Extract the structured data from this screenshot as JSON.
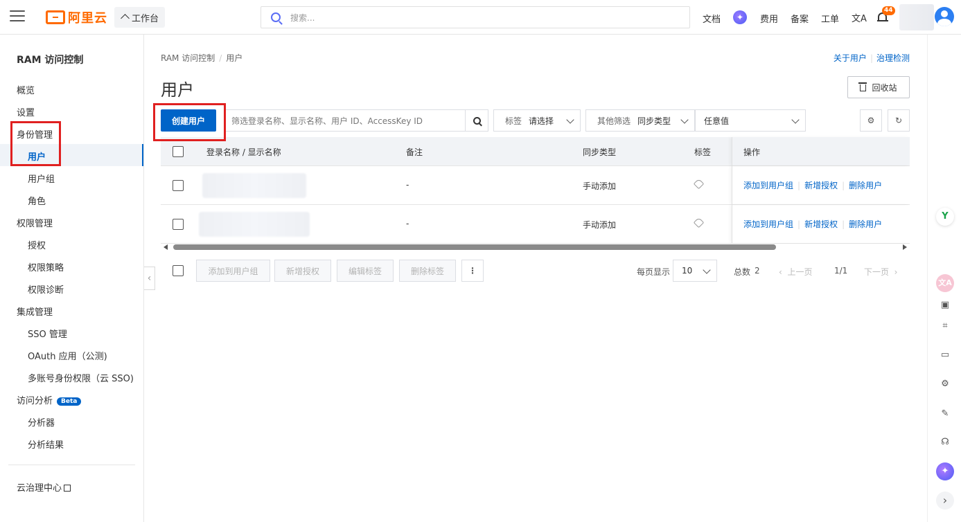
{
  "topnav": {
    "logo_text": "阿里云",
    "workbench": "工作台",
    "search_placeholder": "搜索...",
    "docs": "文档",
    "ai_glyph": "✦",
    "billing": "费用",
    "filing": "备案",
    "ticket": "工单",
    "lang_glyph": "文A",
    "notification_count": "44"
  },
  "sidebar": {
    "title": "RAM 访问控制",
    "items": [
      {
        "label": "概览"
      },
      {
        "label": "设置"
      },
      {
        "label": "身份管理"
      },
      {
        "label": "用户"
      },
      {
        "label": "用户组"
      },
      {
        "label": "角色"
      },
      {
        "label": "权限管理"
      },
      {
        "label": "授权"
      },
      {
        "label": "权限策略"
      },
      {
        "label": "权限诊断"
      },
      {
        "label": "集成管理"
      },
      {
        "label": "SSO 管理"
      },
      {
        "label": "OAuth 应用（公测)"
      },
      {
        "label": "多账号身份权限（云 SSO)"
      },
      {
        "label": "访问分析"
      },
      {
        "label": "分析器"
      },
      {
        "label": "分析结果"
      }
    ],
    "beta_badge": "Beta",
    "footer_link": "云治理中心"
  },
  "main": {
    "breadcrumb": [
      "RAM 访问控制",
      "用户"
    ],
    "breadcrumb_sep": "/",
    "about_users": "关于用户",
    "governance_check": "治理检测",
    "title": "用户",
    "recycle_bin": "回收站",
    "create_user": "创建用户",
    "filter_placeholder": "筛选登录名称、显示名称、用户 ID、AccessKey ID",
    "tag_label": "标签",
    "tag_value": "请选择",
    "other_filter_label": "其他筛选",
    "other_filter_value": "同步类型",
    "any_value": "任意值",
    "settings_glyph": "⚙",
    "refresh_glyph": "↻"
  },
  "table": {
    "headers": {
      "name": "登录名称 / 显示名称",
      "note": "备注",
      "sync_type": "同步类型",
      "tags": "标签",
      "actions": "操作"
    },
    "rows": [
      {
        "note": "-",
        "sync_type": "手动添加"
      },
      {
        "note": "-",
        "sync_type": "手动添加"
      }
    ],
    "row_actions": {
      "add_to_group": "添加到用户组",
      "add_permission": "新增授权",
      "delete_user": "删除用户"
    }
  },
  "bulk": {
    "add_to_group": "添加到用户组",
    "add_permission": "新增授权",
    "edit_tags": "编辑标签",
    "delete_tags": "删除标签",
    "more": "⋮"
  },
  "pager": {
    "per_page_label": "每页显示",
    "per_page_value": "10",
    "total_label": "总数",
    "total_value": "2",
    "prev": "上一页",
    "page_indicator": "1/1",
    "next": "下一页"
  },
  "rail": {
    "y_glyph": "Y",
    "translate_glyph": "文A",
    "expand_glyph": "›"
  },
  "colors": {
    "brand": "#ff6a00",
    "primary": "#0064c8",
    "highlight_box": "#e02020"
  }
}
